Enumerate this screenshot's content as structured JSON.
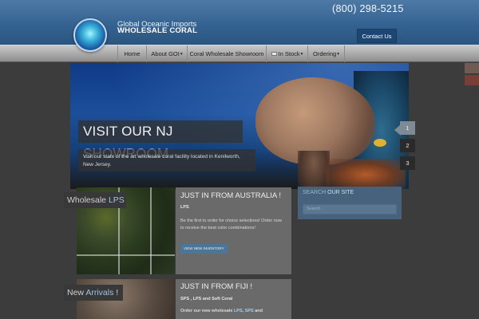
{
  "header": {
    "logo_line1": "Global Oceanic Imports",
    "logo_line2": "WHOLESALE CORAL",
    "phone": "(800) 298-5215",
    "contact_label": "Contact Us"
  },
  "nav": {
    "items": [
      {
        "label": "Home",
        "dropdown": false
      },
      {
        "label": "About GOI",
        "dropdown": true
      },
      {
        "label": "Coral Wholesale Showroom",
        "dropdown": false
      },
      {
        "label": "In Stock",
        "dropdown": true,
        "icon": "flag-icon"
      },
      {
        "label": "Ordering",
        "dropdown": true
      }
    ],
    "caret": "▾"
  },
  "hero": {
    "title": "VISIT OUR NJ SHOWROOM",
    "description": "Visit our state of the art wholesale coral facility located in Kenilworth, New Jersey.",
    "slides": [
      "1",
      "2",
      "3"
    ],
    "active_slide": 1
  },
  "sections": [
    {
      "tag_plain": "Wholesale ",
      "tag_accent": "LPS",
      "title": "JUST IN FROM AUSTRALIA !",
      "subtitle": "LPS",
      "body": "Be the first to order for choice selections! Order now to receive the best color combinations!",
      "button_label": "VIEW NEW INVENTORY"
    },
    {
      "tag_plain": "New ",
      "tag_accent": "Arrivals",
      "tag_suffix": " !",
      "title": "JUST IN FROM FIJI !",
      "subtitle": "SPS , LPS and Soft Coral",
      "body_prefix": "Order our new wholesale ",
      "body_lps": "LPS",
      "body_mid": ", ",
      "body_sps": "SPS",
      "body_suffix": " and"
    }
  ],
  "search": {
    "title_plain": "SEARCH ",
    "title_accent": "OUR SITE",
    "placeholder": "Search"
  },
  "colors": {
    "header_blue": "#3a6896",
    "accent_blue": "#9fc4e6",
    "page_bg": "#3c3c3c"
  }
}
